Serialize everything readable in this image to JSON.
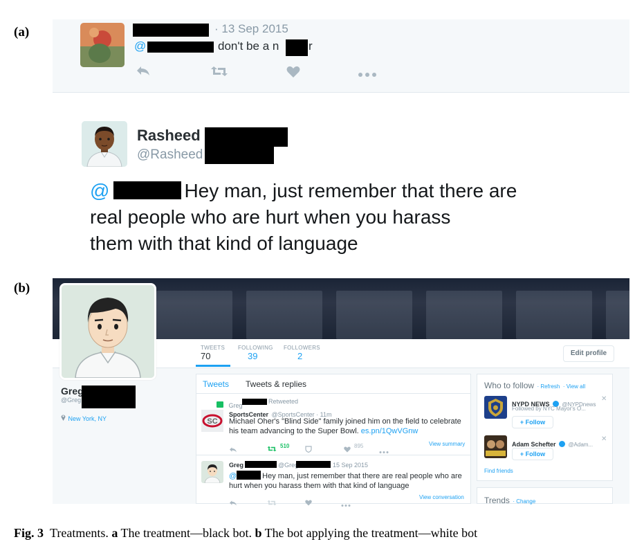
{
  "labels": {
    "a": "(a)",
    "b": "(b)"
  },
  "panel_a": {
    "tweet1": {
      "date": "· 13 Sep 2015",
      "mention_prefix": "@",
      "text_part1": "don't be a n",
      "text_part2": "r"
    },
    "reply": {
      "name": "Rasheed",
      "handle": "@Rasheed",
      "mention_prefix": "@",
      "line1": "Hey man, just remember that there are",
      "line2": "real people who are hurt when you harass",
      "line3": "them with that kind of language"
    }
  },
  "panel_b": {
    "stats": [
      {
        "label": "TWEETS",
        "value": "70"
      },
      {
        "label": "FOLLOWING",
        "value": "39"
      },
      {
        "label": "FOLLOWERS",
        "value": "2"
      }
    ],
    "edit_profile": "Edit profile",
    "profile": {
      "name": "Greg",
      "handle": "@Greg",
      "location": "New York, NY"
    },
    "tabs": {
      "tweets": "Tweets",
      "replies": "Tweets & replies"
    },
    "tweet1": {
      "retweet_by": "Greg",
      "retweeted": "Retweeted",
      "author": "SportsCenter",
      "author_handle": "@SportsCenter · 11m",
      "line1": "Michael Oher's \"Blind Side\" family joined him on the field to celebrate",
      "line2": "his team advancing to the Super Bowl.",
      "link": "es.pn/1QwVGnw",
      "retweets": "510",
      "likes": "895",
      "view_summary": "View summary"
    },
    "tweet2": {
      "name": "Greg",
      "handle": "@Greg",
      "date": "15 Sep 2015",
      "mention_prefix": "@",
      "line1": "Hey man, just remember that there are real people who are",
      "line2": "hurt when you harass them with that kind of language",
      "view_conversation": "View conversation"
    },
    "who_to_follow": {
      "title": "Who to follow",
      "refresh": "· Refresh",
      "view_all": "· View all",
      "accounts": [
        {
          "name": "NYPD NEWS",
          "handle": "@NYPDnews",
          "followed_by": "Followed by NYC Mayor's O...",
          "follow": "Follow"
        },
        {
          "name": "Adam Schefter",
          "handle": "@Adam...",
          "follow": "Follow"
        }
      ],
      "find_friends": "Find friends"
    },
    "trends": {
      "title": "Trends",
      "change": "· Change"
    }
  },
  "caption": {
    "fig": "Fig. 3",
    "text1": "Treatments.",
    "a": "a",
    "text2": "The treatment—black bot.",
    "b": "b",
    "text3": "The bot applying the treatment—white bot"
  },
  "colors": {
    "accent": "#1da1f2",
    "retweet": "#17bf63",
    "muted": "#8899a6"
  }
}
